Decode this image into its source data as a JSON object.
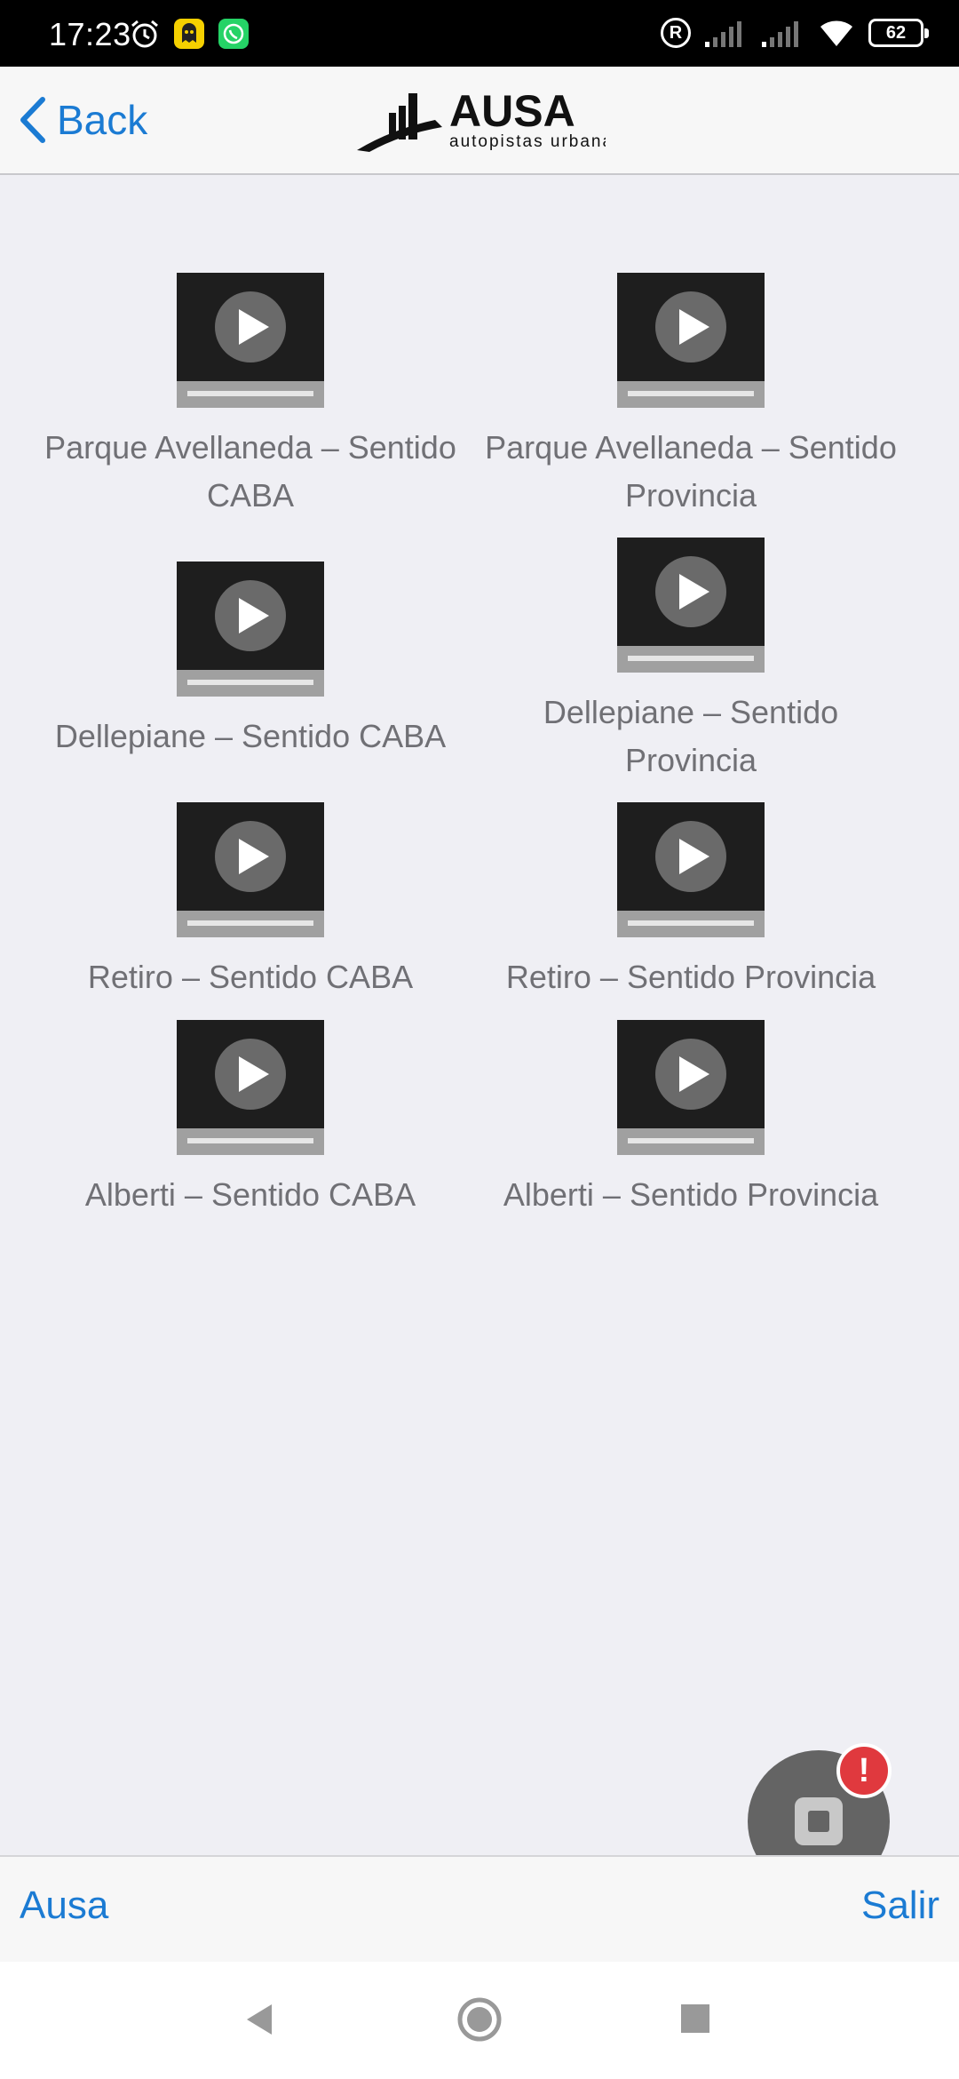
{
  "status_bar": {
    "time": "17:23",
    "battery": "62",
    "left_icons": [
      "alarm-icon",
      "cyberghost-icon",
      "whatsapp-icon"
    ],
    "right_icons": [
      "registered-icon",
      "signal-icon",
      "signal-icon",
      "wifi-icon",
      "battery-icon"
    ]
  },
  "header": {
    "back_label": "Back",
    "logo_title": "AUSA",
    "logo_subtitle": "autopistas urbanas"
  },
  "cameras": [
    {
      "label": "Parque Avellaneda – Sentido CABA"
    },
    {
      "label": "Parque Avellaneda – Sentido Provincia"
    },
    {
      "label": "Dellepiane – Sentido CABA"
    },
    {
      "label": "Dellepiane – Sentido Provincia"
    },
    {
      "label": "Retiro – Sentido CABA"
    },
    {
      "label": "Retiro – Sentido Provincia"
    },
    {
      "label": "Alberti – Sentido CABA"
    },
    {
      "label": "Alberti – Sentido Provincia"
    }
  ],
  "fab": {
    "badge": "!"
  },
  "toolbar": {
    "left_label": "Ausa",
    "right_label": "Salir"
  },
  "colors": {
    "accent": "#1b7bd3",
    "background": "#efeff4",
    "label_text": "#707075",
    "badge": "#e0393e"
  }
}
